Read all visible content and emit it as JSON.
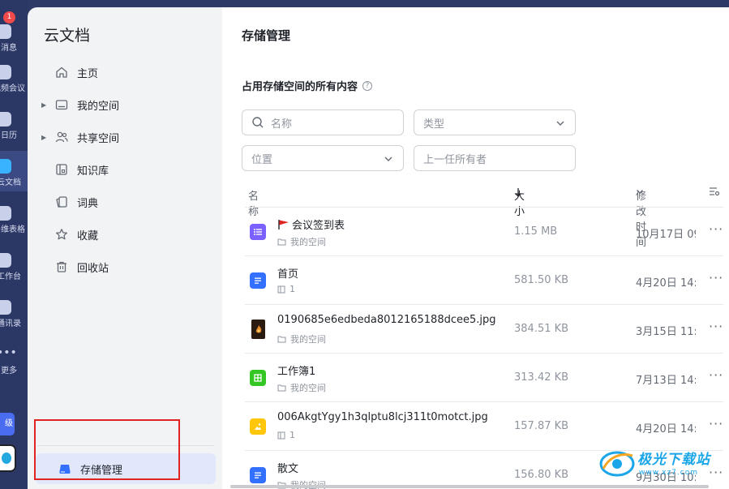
{
  "rail": {
    "badge_count": "1",
    "items": [
      {
        "label": "消息",
        "icon": "chat-icon"
      },
      {
        "label": "视频会议",
        "icon": "video-icon"
      },
      {
        "label": "日历",
        "icon": "calendar-icon"
      },
      {
        "label": "云文档",
        "icon": "cloud-doc-icon"
      },
      {
        "label": "多维表格",
        "icon": "table-icon"
      },
      {
        "label": "工作台",
        "icon": "workbench-icon"
      },
      {
        "label": "通讯录",
        "icon": "contacts-icon"
      },
      {
        "label": "更多",
        "icon": "more-icon"
      }
    ],
    "upgrade_label": "级"
  },
  "nav": {
    "title": "云文档",
    "items": [
      {
        "label": "主页",
        "icon": "home-icon"
      },
      {
        "label": "我的空间",
        "icon": "folder-icon"
      },
      {
        "label": "共享空间",
        "icon": "people-icon"
      },
      {
        "label": "知识库",
        "icon": "wiki-icon"
      },
      {
        "label": "词典",
        "icon": "dictionary-icon"
      },
      {
        "label": "收藏",
        "icon": "star-icon"
      },
      {
        "label": "回收站",
        "icon": "trash-icon"
      }
    ],
    "storage_label": "存储管理"
  },
  "main": {
    "title": "存储管理",
    "section_title": "占用存储空间的所有内容",
    "filters": {
      "name_placeholder": "名称",
      "type_placeholder": "类型",
      "location_placeholder": "位置",
      "owner_placeholder": "上一任所有者"
    },
    "columns": {
      "name": "名称",
      "size": "大小",
      "modified": "修改时间"
    },
    "rows": [
      {
        "name": "会议签到表",
        "prefix_icon": "red-flag-icon",
        "location": "我的空间",
        "location_icon": "folder-icon",
        "size": "1.15 MB",
        "modified": "10月17日 09",
        "file_icon": "form-icon",
        "icon_color": "#7b61ff"
      },
      {
        "name": "首页",
        "location": "1",
        "location_icon": "wiki-icon",
        "size": "581.50 KB",
        "modified": "4月20日 14:",
        "file_icon": "doc-icon",
        "icon_color": "#3370ff"
      },
      {
        "name": "0190685e6edbeda8012165188dcee5.jpg",
        "location": "我的空间",
        "location_icon": "folder-icon",
        "size": "384.51 KB",
        "modified": "3月15日 11:",
        "file_icon": "image-thumbnail-icon",
        "icon_color": "#2a1a10"
      },
      {
        "name": "工作簿1",
        "location": "我的空间",
        "location_icon": "folder-icon",
        "size": "313.42 KB",
        "modified": "7月13日 14:",
        "file_icon": "sheet-icon",
        "icon_color": "#34c724"
      },
      {
        "name": "006AkgtYgy1h3qlptu8lcj311t0motct.jpg",
        "location": "1",
        "location_icon": "wiki-icon",
        "size": "157.87 KB",
        "modified": "4月20日 14:",
        "file_icon": "image-icon",
        "icon_color": "#ffc60a"
      },
      {
        "name": "散文",
        "location": "我的空间",
        "location_icon": "folder-icon",
        "size": "156.80 KB",
        "modified": "9月30日 10:",
        "file_icon": "doc-icon",
        "icon_color": "#3370ff"
      }
    ]
  },
  "watermark": {
    "text": "极光下载站",
    "url": "www.xz7.com"
  }
}
